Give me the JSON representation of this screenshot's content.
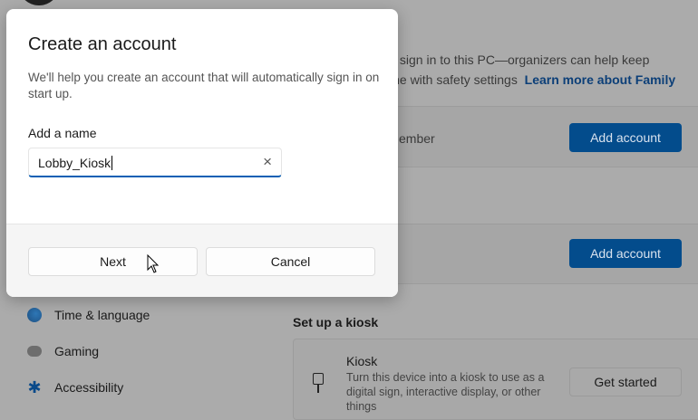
{
  "background": {
    "family_text_line1": "s sign in to this PC—organizers can help keep",
    "family_text_line2": "ine with safety settings",
    "family_link": "Learn more about Family",
    "member_row_label": "ember",
    "add_account_1": "Add account",
    "add_account_2": "Add account",
    "kiosk_section_title": "Set up a kiosk",
    "kiosk_title": "Kiosk",
    "kiosk_desc": "Turn this device into a kiosk to use as a digital sign, interactive display, or other things",
    "get_started": "Get started"
  },
  "sidebar": {
    "items": [
      {
        "label": "Time & language",
        "icon": "globe-clock-icon"
      },
      {
        "label": "Gaming",
        "icon": "gamepad-icon"
      },
      {
        "label": "Accessibility",
        "icon": "accessibility-icon"
      }
    ]
  },
  "dialog": {
    "title": "Create an account",
    "description": "We'll help you create an account that will automatically sign in on start up.",
    "name_label": "Add a name",
    "name_value": "Lobby_Kiosk",
    "clear_icon": "×",
    "next": "Next",
    "cancel": "Cancel"
  }
}
